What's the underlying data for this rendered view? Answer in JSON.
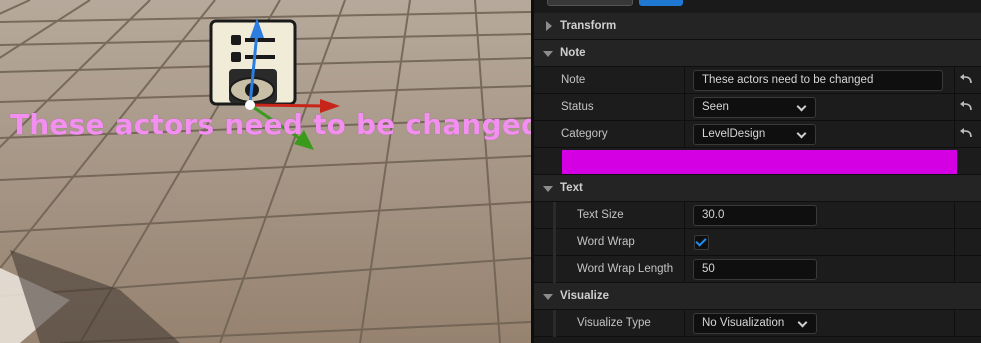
{
  "viewport": {
    "note_text": "These actors need to be changed",
    "note_color": "#f28ff0"
  },
  "panel": {
    "categories": {
      "transform": "Transform",
      "note": "Note",
      "text": "Text",
      "visualize": "Visualize"
    },
    "note": {
      "note_label": "Note",
      "note_value": "These actors need to be changed",
      "status_label": "Status",
      "status_value": "Seen",
      "category_label": "Category",
      "category_value": "LevelDesign",
      "color": "#d400e3"
    },
    "text": {
      "text_size_label": "Text Size",
      "text_size_value": "30.0",
      "word_wrap_label": "Word Wrap",
      "word_wrap_checked": true,
      "word_wrap_length_label": "Word Wrap Length",
      "word_wrap_length_value": "50"
    },
    "visualize": {
      "visualize_type_label": "Visualize Type",
      "visualize_type_value": "No Visualization"
    },
    "accent": "#1f78d1"
  }
}
